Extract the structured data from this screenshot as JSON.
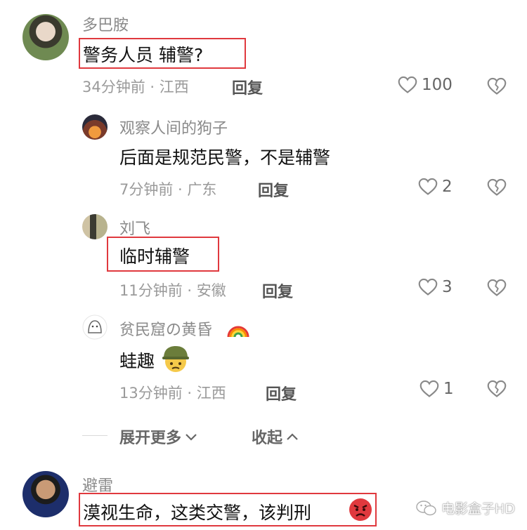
{
  "comments": [
    {
      "name": "多巴胺",
      "text": "警务人员 辅警?",
      "time": "34分钟前 · 江西",
      "reply": "回复",
      "likes": "100"
    },
    {
      "name": "观察人间的狗子",
      "text": "后面是规范民警，不是辅警",
      "time": "7分钟前 · 广东",
      "reply": "回复",
      "likes": "2"
    },
    {
      "name": "刘飞",
      "text": "临时辅警",
      "time": "11分钟前 · 安徽",
      "reply": "回复",
      "likes": "3"
    },
    {
      "name": "贫民窟の黄昏",
      "text": "蛙趣",
      "time": "13分钟前 · 江西",
      "reply": "回复",
      "likes": "1"
    },
    {
      "name": "避雷",
      "text": "漠视生命，这类交警，该判刑"
    }
  ],
  "controls": {
    "expand_more": "展开更多",
    "collapse": "收起"
  },
  "watermark": "电影盒子HD",
  "colors": {
    "highlight_border": "#e0393e",
    "name_gray": "#8a8a8a",
    "meta_gray": "#9a9a9a"
  },
  "icons": [
    "heart-outline-icon",
    "broken-heart-icon",
    "chevron-down-icon",
    "chevron-up-icon",
    "rainbow-emoji",
    "military-helmet-emoji",
    "angry-face-emoji",
    "wechat-logo-icon"
  ]
}
